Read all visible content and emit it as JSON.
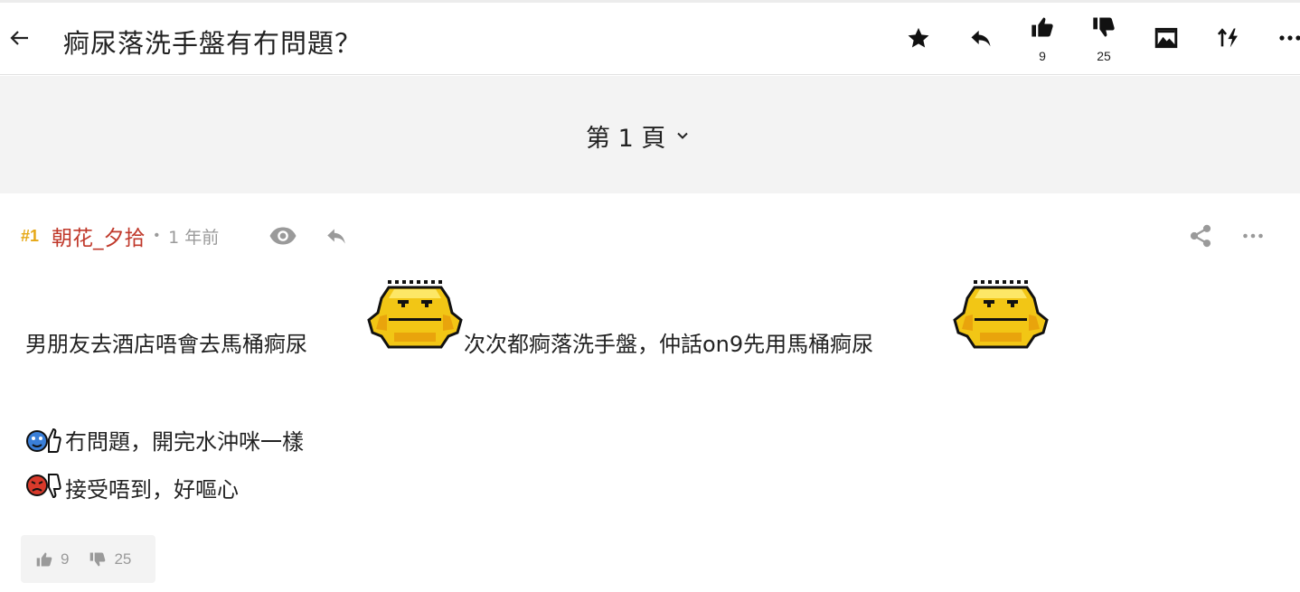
{
  "header": {
    "title": "痾尿落洗手盤有冇問題？",
    "like_count": "9",
    "dislike_count": "25",
    "icons": [
      "back-arrow-icon",
      "star-icon",
      "reply-icon",
      "thumbs-up-icon",
      "thumbs-down-icon",
      "image-icon",
      "sort-icon",
      "more-icon"
    ]
  },
  "pagination": {
    "label": "第 1 頁"
  },
  "post": {
    "floor": "#1",
    "author": "朝花_夕拾",
    "separator": "•",
    "time": "1 年前",
    "line1": {
      "part1": "男朋友去酒店唔會去馬桶痾尿",
      "part2": "次次都痾落洗手盤，仲話on9先用馬桶痾尿"
    },
    "line2": "冇問題，開完水沖咪一樣",
    "line3": "接受唔到，好嘔心",
    "likes": "9",
    "dislikes": "25"
  },
  "colors": {
    "floor": "#e6a817",
    "author": "#c0392b",
    "page_bar": "#f3f3f3",
    "muted": "#9a9a9a"
  }
}
